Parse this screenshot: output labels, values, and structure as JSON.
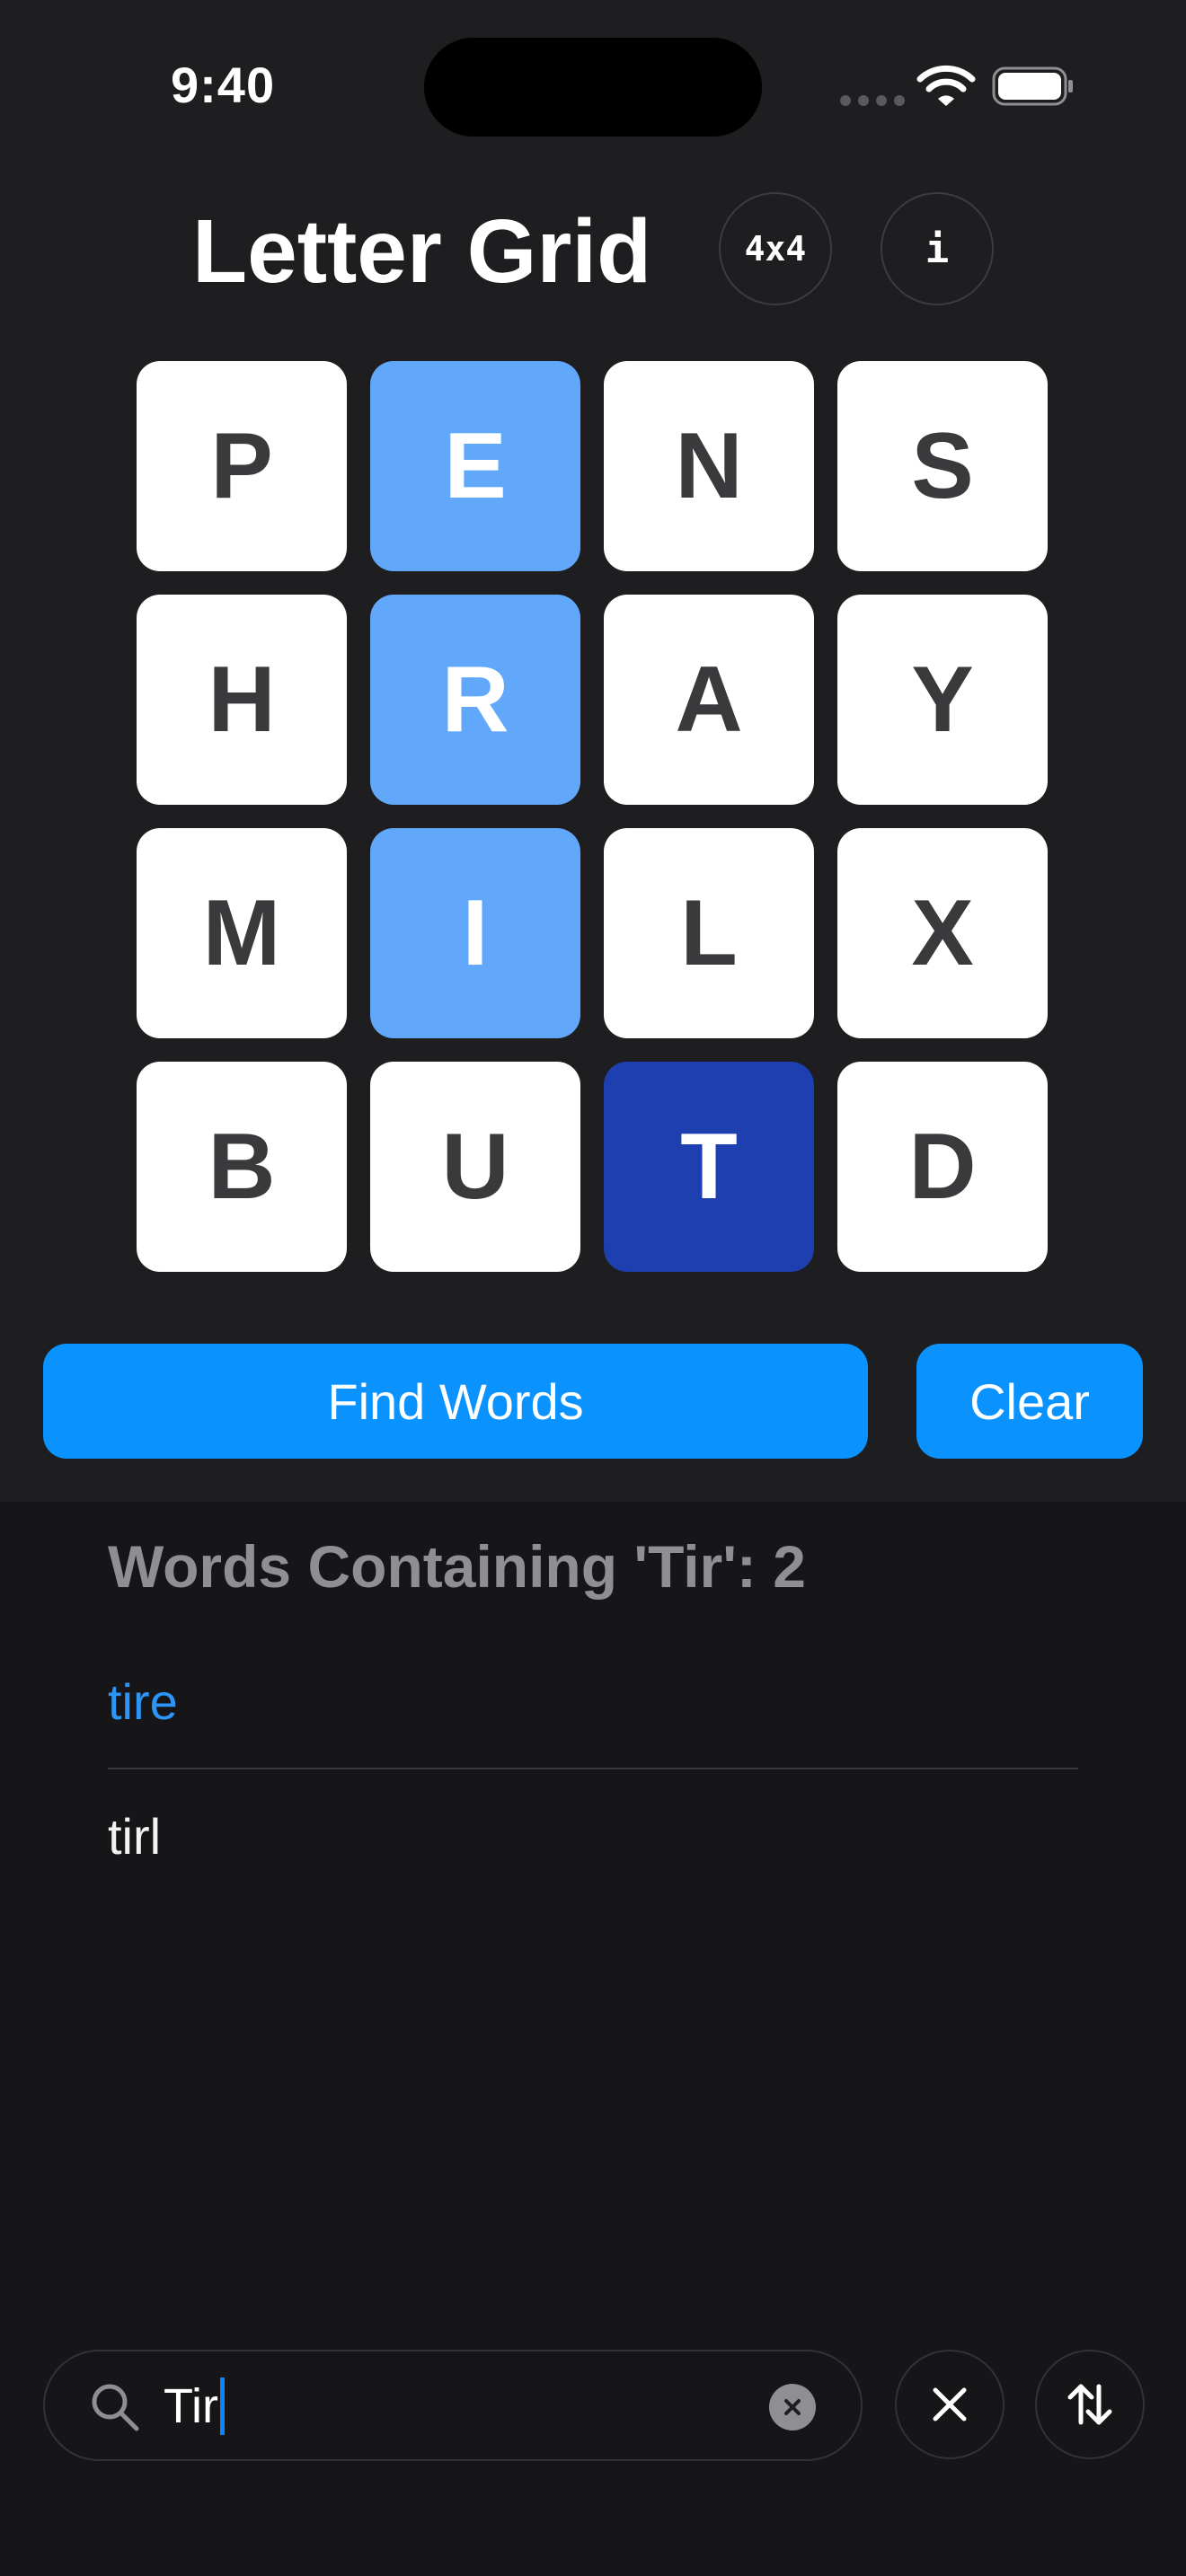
{
  "status_bar": {
    "time": "9:40"
  },
  "header": {
    "title": "Letter Grid",
    "size_label": "4x4",
    "info_label": "i"
  },
  "grid": {
    "rows": [
      [
        "P",
        "E",
        "N",
        "S"
      ],
      [
        "H",
        "R",
        "A",
        "Y"
      ],
      [
        "M",
        "I",
        "L",
        "X"
      ],
      [
        "B",
        "U",
        "T",
        "D"
      ]
    ],
    "selected_path": [
      "E",
      "R",
      "I",
      "T"
    ],
    "colors": {
      "tile": "#ffffff",
      "selected": "#61a8fb",
      "current": "#1d3fb0"
    }
  },
  "actions": {
    "find_label": "Find Words",
    "clear_label": "Clear",
    "accent": "#0a92ff"
  },
  "results": {
    "heading": "Words Containing 'Tir': 2",
    "words": [
      "tire",
      "tirl"
    ]
  },
  "search": {
    "value": "Tir"
  },
  "icons": {
    "search": "search-icon",
    "clear_input": "clear-input-icon",
    "close": "close-icon",
    "sort": "sort-arrows-icon",
    "wifi": "wifi-icon",
    "battery": "battery-icon"
  }
}
